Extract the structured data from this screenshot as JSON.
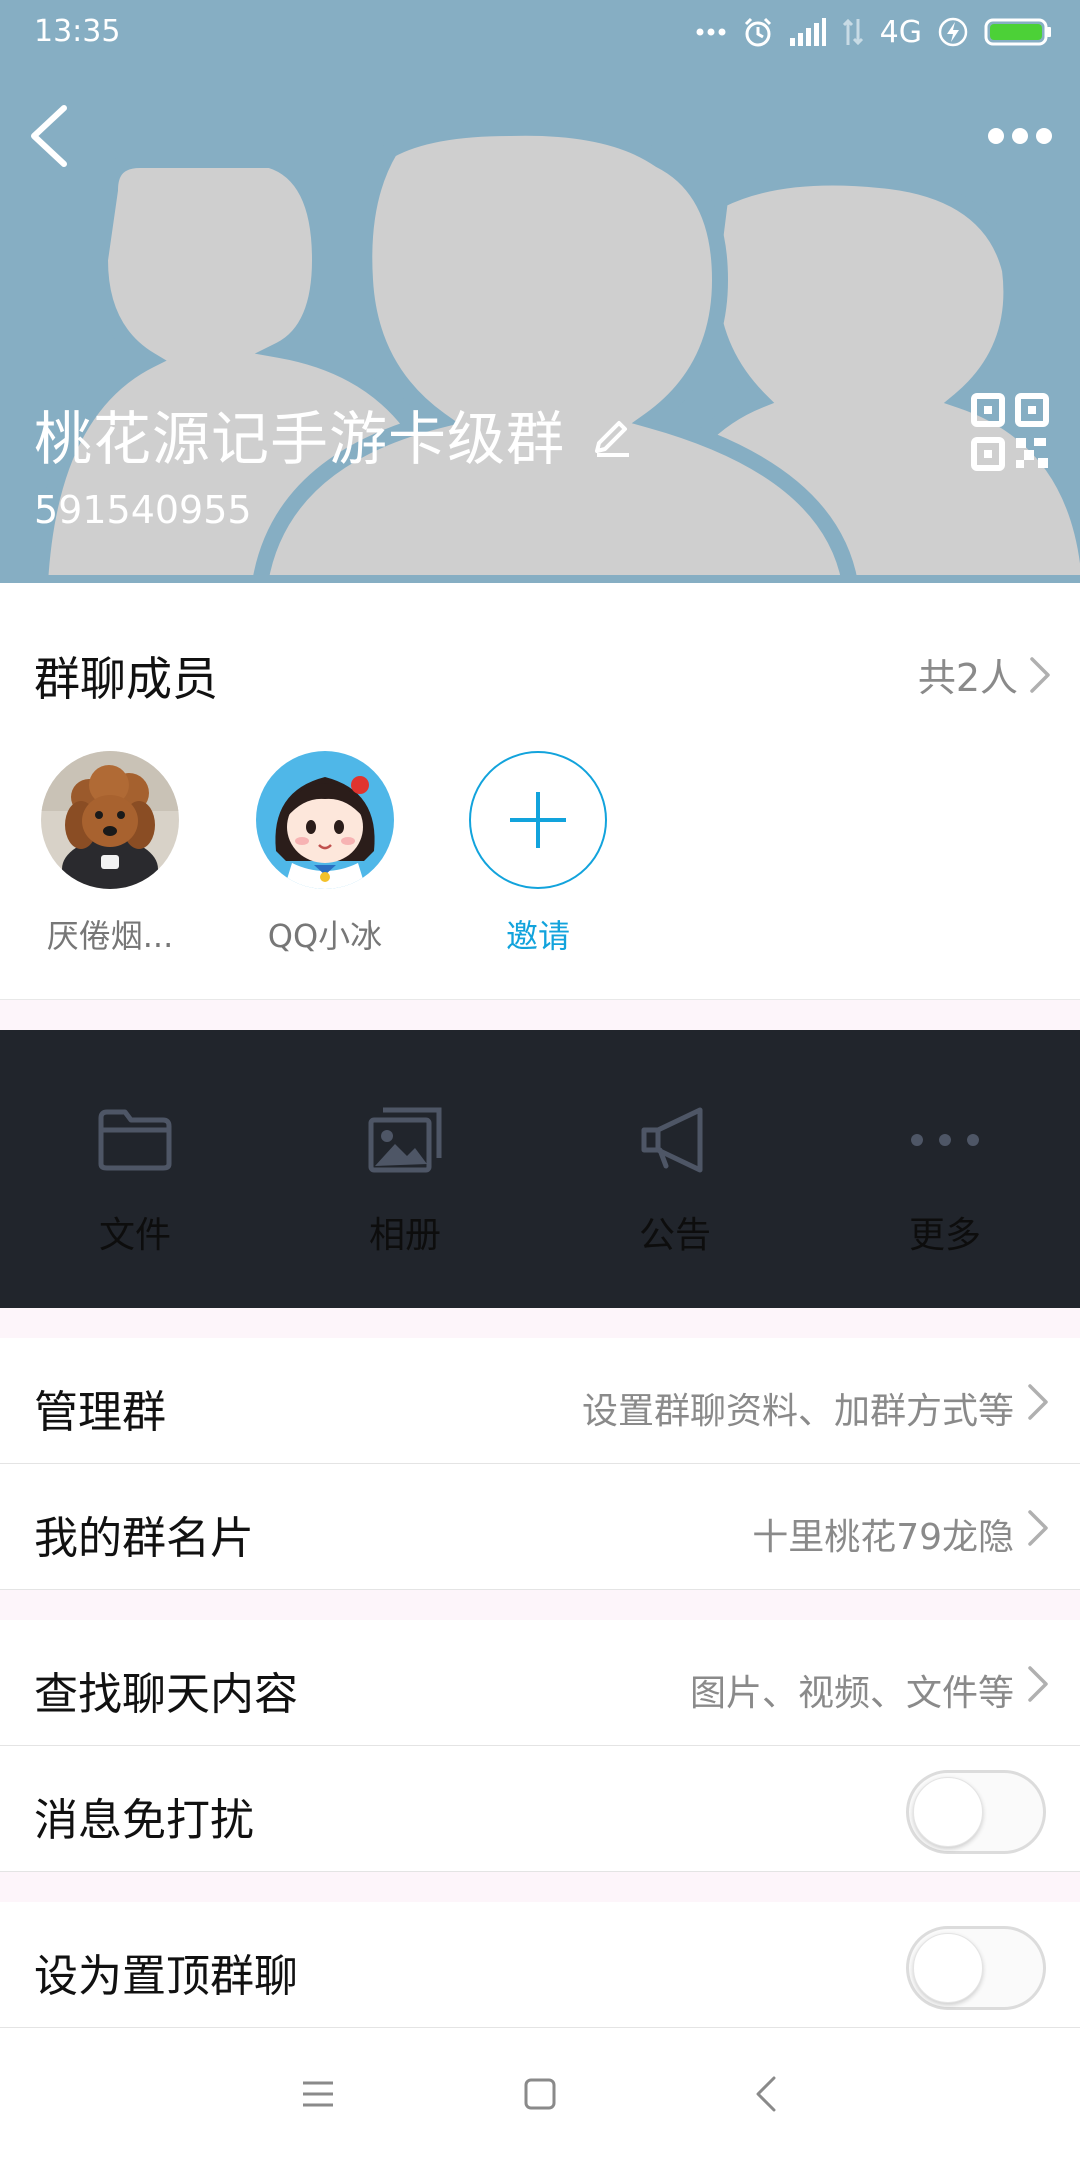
{
  "status_bar": {
    "time": "13:35",
    "network": "4G",
    "battery_color": "#4cd137"
  },
  "header": {
    "group_name": "桃花源记手游卡级群",
    "group_id": "591540955",
    "bg_color": "#86aec3",
    "silhouette_color": "#cfcfcf"
  },
  "members": {
    "title": "群聊成员",
    "count_label": "共2人",
    "items": [
      {
        "name": "厌倦烟...",
        "avatar": "poodle-photo"
      },
      {
        "name": "QQ小冰",
        "avatar": "cartoon-girl"
      }
    ],
    "invite_label": "邀请",
    "accent_color": "#12a3dc"
  },
  "shortcuts": [
    {
      "label": "文件",
      "icon": "folder-icon"
    },
    {
      "label": "相册",
      "icon": "album-icon"
    },
    {
      "label": "公告",
      "icon": "megaphone-icon"
    },
    {
      "label": "更多",
      "icon": "more-icon"
    }
  ],
  "settings": {
    "manage_group": {
      "label": "管理群",
      "value": "设置群聊资料、加群方式等"
    },
    "my_card": {
      "label": "我的群名片",
      "value": "十里桃花79龙隐"
    },
    "search_chat": {
      "label": "查找聊天内容",
      "value": "图片、视频、文件等"
    },
    "mute": {
      "label": "消息免打扰",
      "enabled": false
    },
    "pin_top": {
      "label": "设为置顶群聊",
      "enabled": false
    }
  },
  "navbar": {
    "menu_icon": "menu-icon",
    "home_icon": "home-icon",
    "back_icon": "back-nav-icon"
  }
}
